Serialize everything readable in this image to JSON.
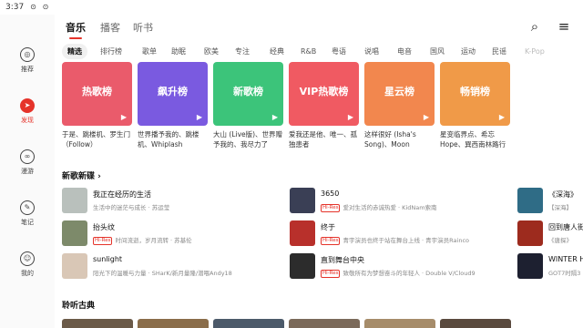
{
  "status_bar": {
    "time": "3:37"
  },
  "sidebar": {
    "items": [
      {
        "label": "推荐",
        "icon": "recommend-icon",
        "active": false
      },
      {
        "label": "发现",
        "icon": "discover-icon",
        "active": true
      },
      {
        "label": "漫游",
        "icon": "roam-icon",
        "active": false
      },
      {
        "label": "笔记",
        "icon": "note-icon",
        "active": false
      },
      {
        "label": "我的",
        "icon": "profile-icon",
        "active": false
      }
    ]
  },
  "top_tabs": [
    {
      "label": "音乐",
      "active": true
    },
    {
      "label": "播客",
      "active": false
    },
    {
      "label": "听书",
      "active": false
    }
  ],
  "chips": [
    "精选",
    "排行榜",
    "歌单",
    "助眠",
    "欧美",
    "专注",
    "经典",
    "R&B",
    "粤语",
    "说唱",
    "电音",
    "国风",
    "运动",
    "民谣",
    "K-Pop"
  ],
  "charts": [
    {
      "title": "热歌榜",
      "desc": "于是、跳楼机、罗生门（Follow）",
      "color": "#ea5b6b"
    },
    {
      "title": "飙升榜",
      "desc": "世界播予我的、跳楼机、Whiplash",
      "color": "#7a5ae0"
    },
    {
      "title": "新歌榜",
      "desc": "大山 (Live版)、世界赠予我的、我尽力了",
      "color": "#3cc47a"
    },
    {
      "title": "VIP热歌榜",
      "desc": "爱我还是他、唯一、孤独患者",
      "color": "#f05a62"
    },
    {
      "title": "星云榜",
      "desc": "这样很好 (Isha's Song)、Moon Rock…",
      "color": "#f2874e"
    },
    {
      "title": "畅销榜",
      "desc": "星变临界点、希忘Hope、巽西南林路行",
      "color": "#f09a48"
    }
  ],
  "new_songs": {
    "title": "新歌新碟 ›",
    "hires_label": "Hi-Res",
    "columns": [
      [
        {
          "title": "我正在经历的生活",
          "sub": "生活中的迷茫与成长 · 苏运莹",
          "hires": false,
          "thumb": "#b9c0bc"
        },
        {
          "title": "抬头纹",
          "sub": "时间流逝，岁月流转 · 苏基伦",
          "hires": true,
          "thumb": "#7d8a6a"
        },
        {
          "title": "sunlight",
          "sub": "阳光下的温暖与力量 · SHarK/新月量隆/潜喂Andy18",
          "hires": false,
          "thumb": "#d9c7b6"
        }
      ],
      [
        {
          "title": "3650",
          "sub": "爱对生活的赤诚热爱 · KidNam索南",
          "hires": true,
          "thumb": "#3a3f55"
        },
        {
          "title": "终于",
          "sub": "青宇演员也终于站在舞台上线 · 青宇演员Rainco",
          "hires": true,
          "thumb": "#b8302b"
        },
        {
          "title": "直到舞台中央",
          "sub": "致敬所有为梦想奋斗的年轻人 · Double V/Cloud9",
          "hires": true,
          "thumb": "#2c2c2c"
        }
      ],
      [
        {
          "title": "《深海》",
          "sub": "【深海】",
          "hires": false,
          "thumb": "#2f6c86"
        },
        {
          "title": "回到唐人街",
          "sub": "《唐探》",
          "hires": false,
          "thumb": "#9d2b1e"
        },
        {
          "title": "WINTER H",
          "sub": "GOT7时隔3",
          "hires": false,
          "thumb": "#1d2030"
        }
      ]
    ]
  },
  "classics": {
    "title": "聆听古典",
    "thumbs": [
      "#6b5a48",
      "#8a6d4a",
      "#4c5a6a",
      "#7b6a5a",
      "#a68c6a",
      "#5a4a3e"
    ]
  }
}
